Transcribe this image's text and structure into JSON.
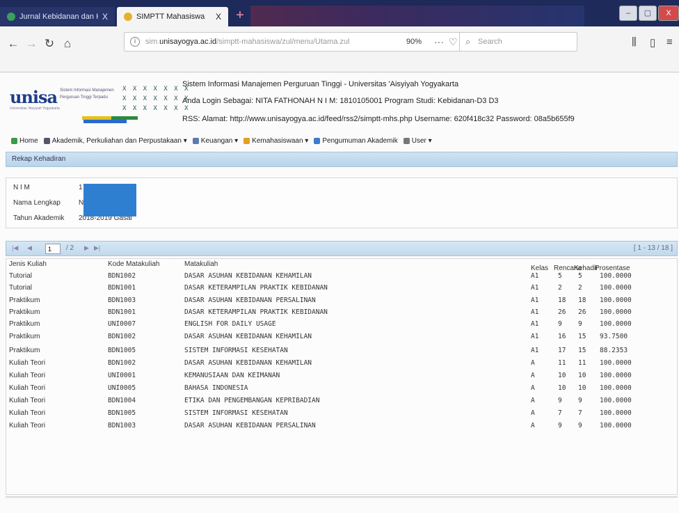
{
  "browser": {
    "tabs": [
      {
        "label": "Jurnal Kebidanan dan Kepera",
        "close": "X"
      },
      {
        "label": "SIMPTT Mahasiswa",
        "close": "X"
      }
    ],
    "new_tab": "+",
    "window_controls": {
      "min": "–",
      "max": "▢",
      "close": "X"
    },
    "url_prefix": "sim.",
    "url_host": "unisayogya.ac.id",
    "url_path": "/simptt-mahasiswa/zul/menu/Utama.zul",
    "zoom": "90%",
    "search_placeholder": "Search"
  },
  "header": {
    "logo": "unisa",
    "logo_subtitle": "Universitas 'Aisyiyah Yogyakarta",
    "tagline_1": "Sistem Informasi Manajemen",
    "tagline_2": "Perguruan Tinggi Terpadu",
    "x_strip": "X X X X X X X",
    "line_1": "Sistem Informasi Manajemen Perguruan Tinggi - Universitas 'Aisyiyah Yogyakarta",
    "line_2": "Anda Login Sebagai: NITA FATHONAH   N I M: 1810105001   Program Studi: Kebidanan-D3 D3",
    "line_3": "RSS:   Alamat: http://www.unisayogya.ac.id/feed/rss2/simptt-mhs.php   Username: 620f418c32   Password: 08a5b655f9"
  },
  "menu": [
    {
      "label": "Home",
      "color": "#3a9a4a"
    },
    {
      "label": "Akademik, Perkuliahan dan Perpustakaan",
      "color": "#556"
    },
    {
      "label": "Keuangan",
      "color": "#5a7ab0"
    },
    {
      "label": "Kemahasiswaan",
      "color": "#e0a020"
    },
    {
      "label": "Pengumuman Akademik",
      "color": "#3a7ad0"
    },
    {
      "label": "User",
      "color": "#777"
    }
  ],
  "panel_title": "Rekap Kehadiran",
  "form": {
    "nim_label": "N I M",
    "nim_value": "1",
    "nama_label": "Nama Lengkap",
    "nama_value": "N",
    "tahun_label": "Tahun Akademik",
    "tahun_value": "2018-2019 Gasal"
  },
  "pager": {
    "first": "|◀",
    "prev": "◀",
    "page": "1",
    "of": "/ 2",
    "next": "▶",
    "last": "▶|",
    "info": "[ 1 - 13 / 18 ]"
  },
  "table": {
    "headers": {
      "jenis": "Jenis Kuliah",
      "kode": "Kode Matakuliah",
      "matakuliah": "Matakuliah",
      "kelas": "Kelas",
      "rencana": "Rencana",
      "kehadiran": "Kehadiran",
      "prosentase": "Prosentase"
    },
    "rows": [
      {
        "jenis": "Tutorial",
        "kode": "BDN1002",
        "mk": "DASAR ASUHAN KEBIDANAN KEHAMILAN",
        "kelas": "A1",
        "rencana": "5",
        "hadir": "5",
        "pct": "100.0000"
      },
      {
        "jenis": "Tutorial",
        "kode": "BDN1001",
        "mk": "DASAR KETERAMPILAN PRAKTIK KEBIDANAN",
        "kelas": "A1",
        "rencana": "2",
        "hadir": "2",
        "pct": "100.0000"
      },
      {
        "jenis": "Praktikum",
        "kode": "BDN1003",
        "mk": "DASAR ASUHAN KEBIDANAN PERSALINAN",
        "kelas": "A1",
        "rencana": "18",
        "hadir": "18",
        "pct": "100.0000"
      },
      {
        "jenis": "Praktikum",
        "kode": "BDN1001",
        "mk": "DASAR KETERAMPILAN PRAKTIK KEBIDANAN",
        "kelas": "A1",
        "rencana": "26",
        "hadir": "26",
        "pct": "100.0000"
      },
      {
        "jenis": "Praktikum",
        "kode": "UNI0007",
        "mk": "ENGLISH FOR DAILY USAGE",
        "kelas": "A1",
        "rencana": "9",
        "hadir": "9",
        "pct": "100.0000"
      },
      {
        "jenis": "Praktikum",
        "kode": "BDN1002",
        "mk": "DASAR ASUHAN KEBIDANAN KEHAMILAN",
        "kelas": "A1",
        "rencana": "16",
        "hadir": "15",
        "pct": "93.7500"
      },
      {
        "jenis": "Praktikum",
        "kode": "BDN1005",
        "mk": "SISTEM INFORMASI KESEHATAN",
        "kelas": "A1",
        "rencana": "17",
        "hadir": "15",
        "pct": "88.2353"
      },
      {
        "jenis": "Kuliah Teori",
        "kode": "BDN1002",
        "mk": "DASAR ASUHAN KEBIDANAN KEHAMILAN",
        "kelas": "A",
        "rencana": "11",
        "hadir": "11",
        "pct": "100.0000"
      },
      {
        "jenis": "Kuliah Teori",
        "kode": "UNI0001",
        "mk": "KEMANUSIAAN DAN KEIMANAN",
        "kelas": "A",
        "rencana": "10",
        "hadir": "10",
        "pct": "100.0000"
      },
      {
        "jenis": "Kuliah Teori",
        "kode": "UNI0005",
        "mk": "BAHASA INDONESIA",
        "kelas": "A",
        "rencana": "10",
        "hadir": "10",
        "pct": "100.0000"
      },
      {
        "jenis": "Kuliah Teori",
        "kode": "BDN1004",
        "mk": "ETIKA DAN PENGEMBANGAN KEPRIBADIAN",
        "kelas": "A",
        "rencana": "9",
        "hadir": "9",
        "pct": "100.0000"
      },
      {
        "jenis": "Kuliah Teori",
        "kode": "BDN1005",
        "mk": "SISTEM INFORMASI KESEHATAN",
        "kelas": "A",
        "rencana": "7",
        "hadir": "7",
        "pct": "100.0000"
      },
      {
        "jenis": "Kuliah Teori",
        "kode": "BDN1003",
        "mk": "DASAR ASUHAN KEBIDANAN PERSALINAN",
        "kelas": "A",
        "rencana": "9",
        "hadir": "9",
        "pct": "100.0000"
      }
    ]
  }
}
